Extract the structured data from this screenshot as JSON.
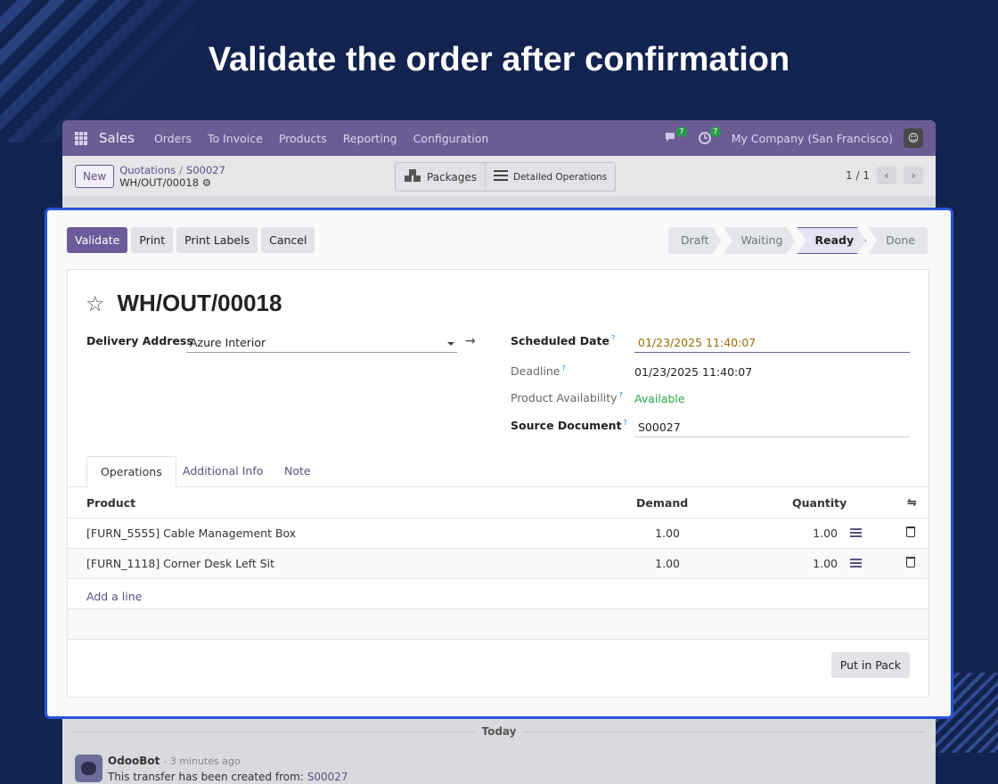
{
  "headline": "Validate the order after confirmation",
  "navbar": {
    "app_name": "Sales",
    "items": [
      "Orders",
      "To Invoice",
      "Products",
      "Reporting",
      "Configuration"
    ],
    "messages_badge": "7",
    "activities_badge": "7",
    "company": "My Company (San Francisco)"
  },
  "control": {
    "new_label": "New",
    "breadcrumb_parent": "Quotations",
    "breadcrumb_sep": "/",
    "breadcrumb_order": "S00027",
    "breadcrumb_current": "WH/OUT/00018",
    "packages_label": "Packages",
    "detailed_ops_label": "Detailed Operations",
    "pager": "1 / 1"
  },
  "actions": {
    "validate": "Validate",
    "print": "Print",
    "print_labels": "Print Labels",
    "cancel": "Cancel"
  },
  "status_stages": [
    "Draft",
    "Waiting",
    "Ready",
    "Done"
  ],
  "active_stage": "Ready",
  "record": {
    "title": "WH/OUT/00018",
    "delivery_address_label": "Delivery Address",
    "delivery_address": "Azure Interior",
    "scheduled_date_label": "Scheduled Date",
    "scheduled_date": "01/23/2025 11:40:07",
    "deadline_label": "Deadline",
    "deadline": "01/23/2025 11:40:07",
    "availability_label": "Product Availability",
    "availability": "Available",
    "source_doc_label": "Source Document",
    "source_doc": "S00027",
    "help_mark": "?"
  },
  "tabs": [
    "Operations",
    "Additional Info",
    "Note"
  ],
  "table": {
    "headers": {
      "product": "Product",
      "demand": "Demand",
      "quantity": "Quantity"
    },
    "rows": [
      {
        "product": "[FURN_5555] Cable Management Box",
        "demand": "1.00",
        "quantity": "1.00"
      },
      {
        "product": "[FURN_1118] Corner Desk Left Sit",
        "demand": "1.00",
        "quantity": "1.00"
      }
    ],
    "add_line": "Add a line"
  },
  "put_in_pack": "Put in Pack",
  "chatter": {
    "today": "Today",
    "author": "OdooBot",
    "time": "- 3 minutes ago",
    "message": "This transfer has been created from:",
    "message_link": "S00027"
  },
  "colors": {
    "background": "#13234f",
    "navbar": "#6b5c94",
    "primary": "#6d5a9a",
    "highlight_border": "#2954d6",
    "available": "#28a745",
    "scheduled_date": "#9a6a00"
  }
}
